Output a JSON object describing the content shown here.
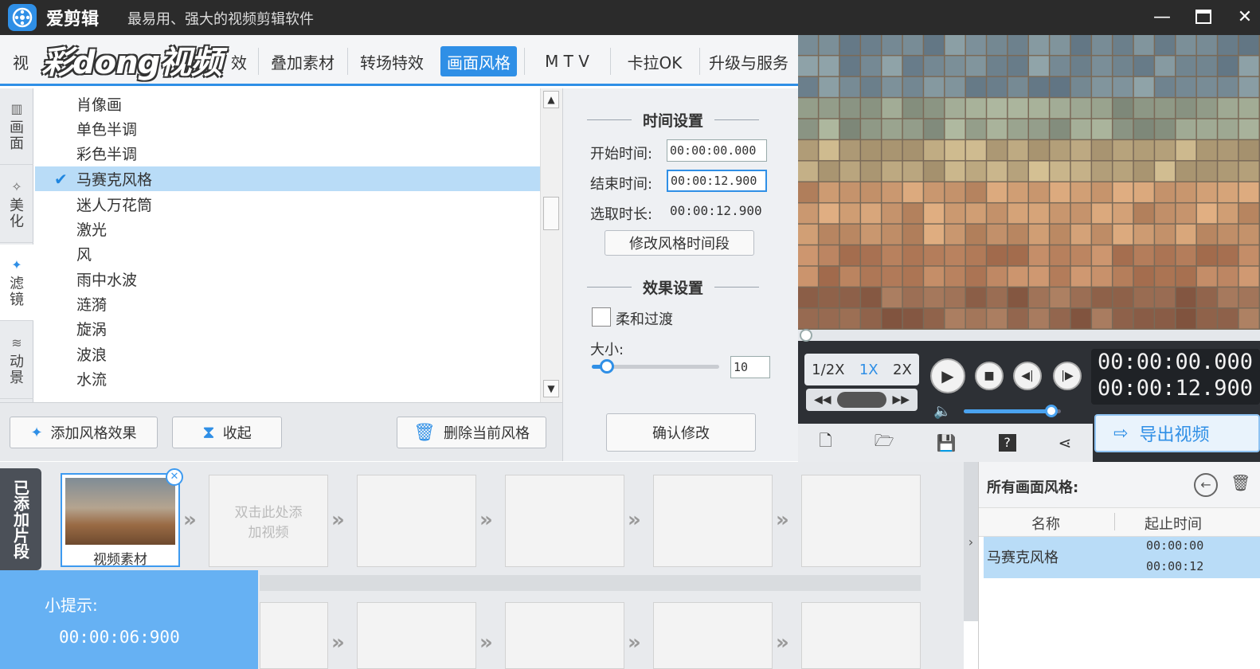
{
  "app": {
    "title": "爱剪辑",
    "slogan": "最易用、强大的视频剪辑软件"
  },
  "watermark": "彩dong视频",
  "tabs": [
    {
      "label": "视"
    },
    {
      "label": "效"
    },
    {
      "label": "叠加素材"
    },
    {
      "label": "转场特效"
    },
    {
      "label": "画面风格"
    },
    {
      "label": "M T V"
    },
    {
      "label": "卡拉OK"
    },
    {
      "label": "升级与服务"
    }
  ],
  "sidetabs": [
    {
      "label": "画面"
    },
    {
      "label": "美化"
    },
    {
      "label": "滤镜"
    },
    {
      "label": "动景"
    }
  ],
  "filters": [
    "肖像画",
    "单色半调",
    "彩色半调",
    "马赛克风格",
    "迷人万花筒",
    "激光",
    "风",
    "雨中水波",
    "涟漪",
    "旋涡",
    "波浪",
    "水流"
  ],
  "buttons": {
    "add_style": "添加风格效果",
    "collapse": "收起",
    "delete_style": "删除当前风格",
    "confirm": "确认修改",
    "modify_range": "修改风格时间段"
  },
  "time_settings": {
    "title": "时间设置",
    "start_label": "开始时间:",
    "start_value": "00:00:00.000",
    "end_label": "结束时间:",
    "end_value": "00:00:12.900",
    "dur_label": "选取时长:",
    "dur_value": "00:00:12.900"
  },
  "effect_settings": {
    "title": "效果设置",
    "smooth_label": "柔和过渡",
    "size_label": "大小:",
    "size_value": "10",
    "size_fraction": 0.12
  },
  "player": {
    "speeds": [
      "1/2X",
      "1X",
      "2X"
    ],
    "time_current": "00:00:00.000",
    "time_total": "00:00:12.900",
    "export_label": "导出视频",
    "volume_fraction": 0.9
  },
  "timeline": {
    "label": "已添加片段",
    "clip_name": "视频素材",
    "add_hint": "双击此处添加视频"
  },
  "hint": {
    "title": "小提示:",
    "time": "00:00:06:900"
  },
  "right_panel": {
    "title": "所有画面风格:",
    "col_name": "名称",
    "col_time": "起止时间",
    "row": {
      "name": "马赛克风格",
      "start": "00:00:00",
      "end": "00:00:12"
    }
  },
  "colors": {
    "accent": "#2f8fe6",
    "selected": "#b9dcf7",
    "hint_bg": "#66b1f3"
  }
}
